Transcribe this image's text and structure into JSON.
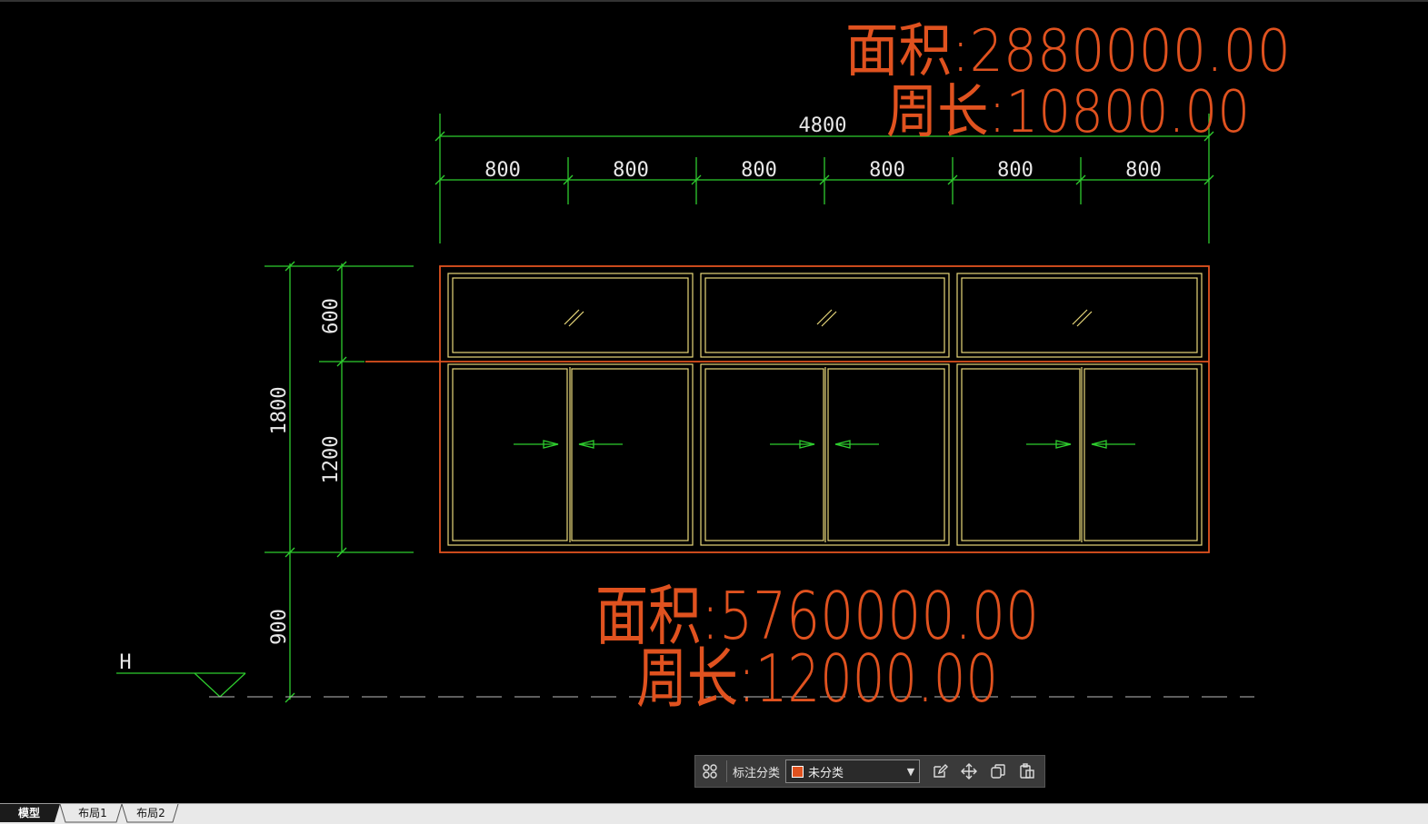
{
  "drawing": {
    "area_top": "面积:2880000.00",
    "perimeter_top": "周长:10800.00",
    "area_bottom": "面积:5760000.00",
    "perimeter_bottom": "周长:12000.00",
    "dim_total_width": "4800",
    "dim_segments": [
      "800",
      "800",
      "800",
      "800",
      "800",
      "800"
    ],
    "dim_total_height": "1800",
    "dim_upper": "600",
    "dim_lower": "1200",
    "dim_sill": "900",
    "level_mark": "H"
  },
  "toolbar": {
    "label": "标注分类",
    "selected": "未分类",
    "swatch_color": "#e0521f"
  },
  "tabs": [
    "模型",
    "布局1",
    "布局2"
  ],
  "colors": {
    "dimension": "#2ecc2e",
    "outline": "#e0521f",
    "frame": "#e8d87a",
    "background": "#000000"
  }
}
